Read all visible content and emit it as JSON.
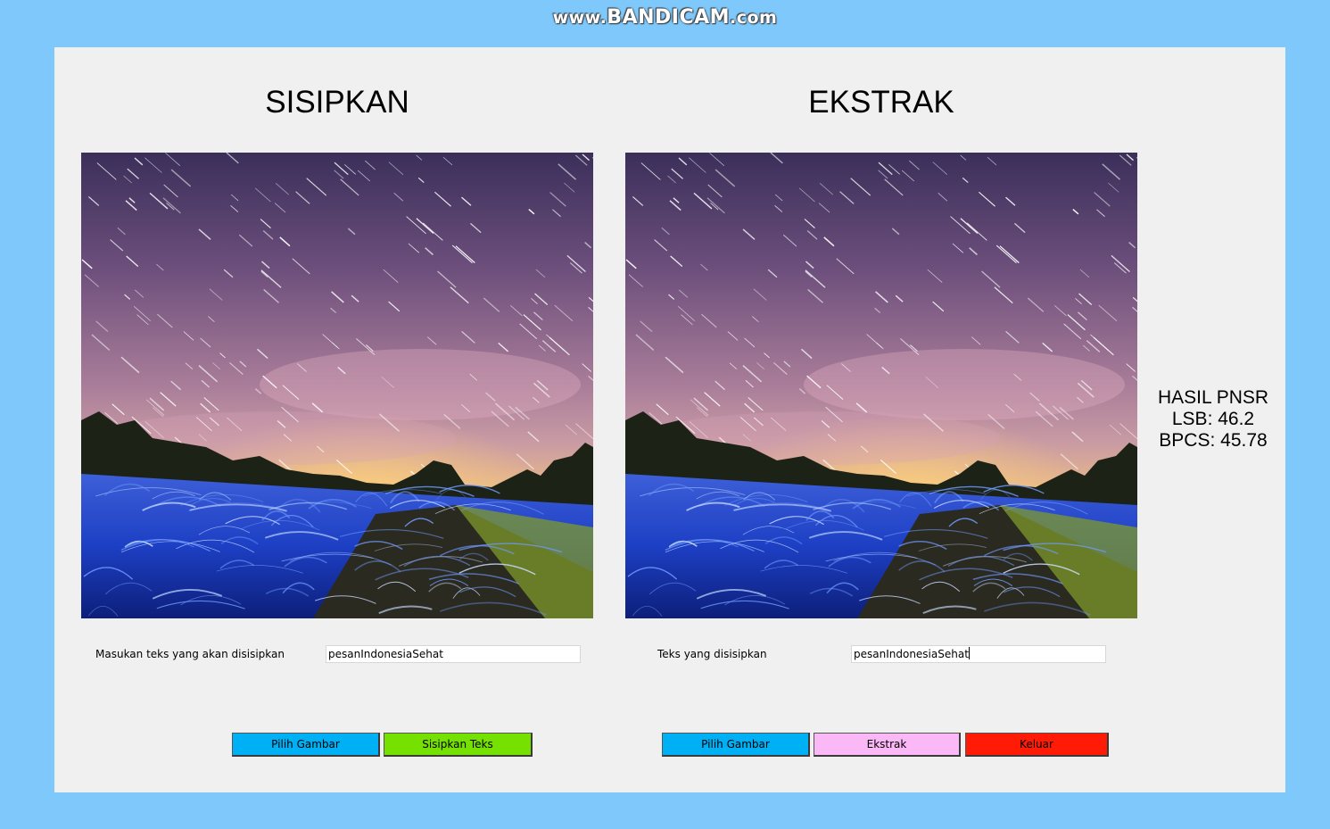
{
  "watermark": {
    "prefix": "www.",
    "brand": "BANDICAM",
    "suffix": ".com"
  },
  "left_panel": {
    "title": "SISIPKAN",
    "input_label": "Masukan teks yang akan disisipkan",
    "input_value": "pesanIndonesiaSehat",
    "buttons": {
      "choose_image": "Pilih Gambar",
      "embed_text": "Sisipkan Teks"
    }
  },
  "right_panel": {
    "title": "EKSTRAK",
    "input_label": "Teks yang disisipkan",
    "input_value": "pesanIndonesiaSehat",
    "buttons": {
      "choose_image": "Pilih Gambar",
      "extract": "Ekstrak",
      "exit": "Keluar"
    }
  },
  "psnr": {
    "heading": "HASIL PNSR",
    "lsb": "LSB: 46.2",
    "bpcs": "BPCS: 45.78"
  },
  "colors": {
    "background": "#7ec8fb",
    "window": "#f0f0f0",
    "choose_button": "#00b0f5",
    "embed_button": "#74e101",
    "extract_button": "#fbb8f7",
    "exit_button": "#ff1b05"
  },
  "images": {
    "cover": "night-sky-star-trails-landscape",
    "stego": "night-sky-star-trails-landscape"
  }
}
